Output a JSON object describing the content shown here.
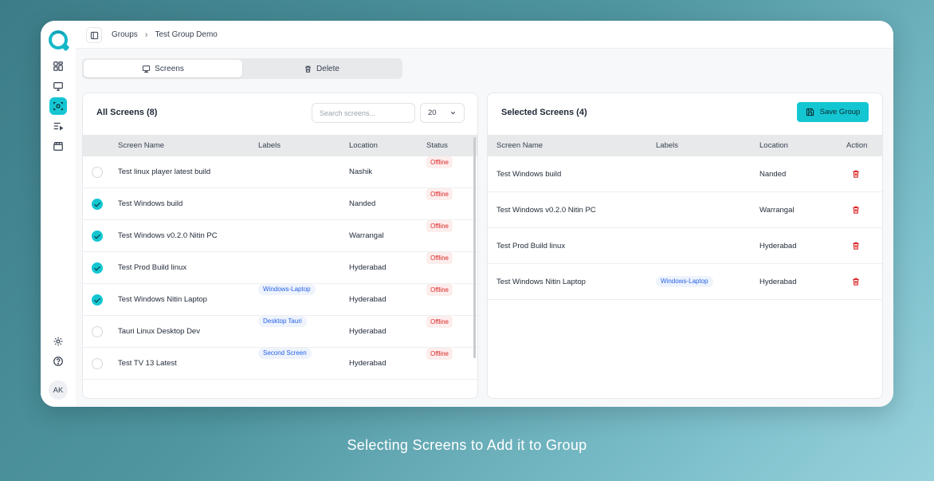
{
  "breadcrumb": [
    "Groups",
    "Test Group Demo"
  ],
  "tabs": [
    {
      "label": "Screens",
      "icon": "cast-icon",
      "active": true
    },
    {
      "label": "Delete",
      "icon": "trash-icon",
      "active": false
    }
  ],
  "all_screens": {
    "title": "All Screens (8)",
    "search_placeholder": "Search screens...",
    "page_size": "20",
    "columns": [
      "Screen Name",
      "Labels",
      "Location",
      "Status"
    ],
    "rows": [
      {
        "checked": false,
        "name": "Test linux player latest build",
        "label": "",
        "location": "Nashik",
        "status": "Offline"
      },
      {
        "checked": true,
        "name": "Test Windows build",
        "label": "",
        "location": "Nanded",
        "status": "Offline"
      },
      {
        "checked": true,
        "name": "Test Windows v0.2.0 Nitin PC",
        "label": "",
        "location": "Warrangal",
        "status": "Offline"
      },
      {
        "checked": true,
        "name": "Test Prod Build linux",
        "label": "",
        "location": "Hyderabad",
        "status": "Offline"
      },
      {
        "checked": true,
        "name": "Test Windows Nitin Laptop",
        "label": "Windows-Laptop",
        "location": "Hyderabad",
        "status": "Offline"
      },
      {
        "checked": false,
        "name": "Tauri Linux Desktop Dev",
        "label": "Desktop Tauri",
        "location": "Hyderabad",
        "status": "Offline"
      },
      {
        "checked": false,
        "name": "Test TV 13 Latest",
        "label": "Second Screen",
        "location": "Hyderabad",
        "status": "Offline"
      }
    ]
  },
  "selected_screens": {
    "title": "Selected Screens (4)",
    "save_label": "Save Group",
    "columns": [
      "Screen Name",
      "Labels",
      "Location",
      "Action"
    ],
    "rows": [
      {
        "name": "Test Windows build",
        "label": "",
        "location": "Nanded"
      },
      {
        "name": "Test Windows v0.2.0 Nitin PC",
        "label": "",
        "location": "Warrangal"
      },
      {
        "name": "Test Prod Build linux",
        "label": "",
        "location": "Hyderabad"
      },
      {
        "name": "Test Windows Nitin Laptop",
        "label": "Windows-Laptop",
        "location": "Hyderabad"
      }
    ]
  },
  "user": {
    "initials": "AK"
  },
  "caption": "Selecting Screens to Add it to Group",
  "colors": {
    "accent": "#14c6d2",
    "danger": "#dc2626",
    "chip_text": "#2563eb"
  }
}
